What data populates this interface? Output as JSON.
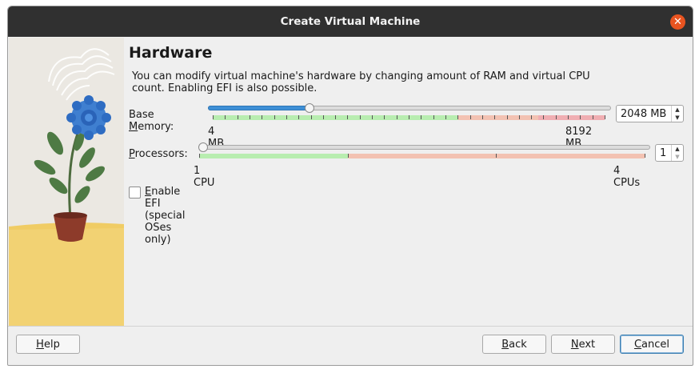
{
  "window": {
    "title": "Create Virtual Machine"
  },
  "page": {
    "heading": "Hardware",
    "description_line1": "You can modify virtual machine's hardware by changing amount of RAM and virtual CPU",
    "description_line2": "count. Enabling EFI is also possible."
  },
  "memory": {
    "label_mnemonic_before": "Base ",
    "label_mnemonic_char": "M",
    "label_mnemonic_after": "emory:",
    "min_label": "4 MB",
    "max_label": "8192 MB",
    "value": "2048 MB",
    "slider_fraction": 0.25
  },
  "processors": {
    "label_mnemonic_char": "P",
    "label_mnemonic_after": "rocessors:",
    "min_label": "1 CPU",
    "max_label": "4 CPUs",
    "value": "1",
    "slider_fraction": 0.0
  },
  "efi": {
    "label_mnemonic_char": "E",
    "label_after": "nable EFI (special OSes only)",
    "checked": false
  },
  "buttons": {
    "help_char": "H",
    "help_rest": "elp",
    "back_char": "B",
    "back_rest": "ack",
    "next_char": "N",
    "next_rest": "ext",
    "cancel_char": "C",
    "cancel_rest": "ancel"
  },
  "colors": {
    "titlebar": "#303030",
    "close_accent": "#e95420",
    "slider_fill": "#3d8fd6",
    "safe_range": "#b8edb0",
    "warn_range": "#f3c2b2",
    "danger_range": "#f0aeb2"
  }
}
